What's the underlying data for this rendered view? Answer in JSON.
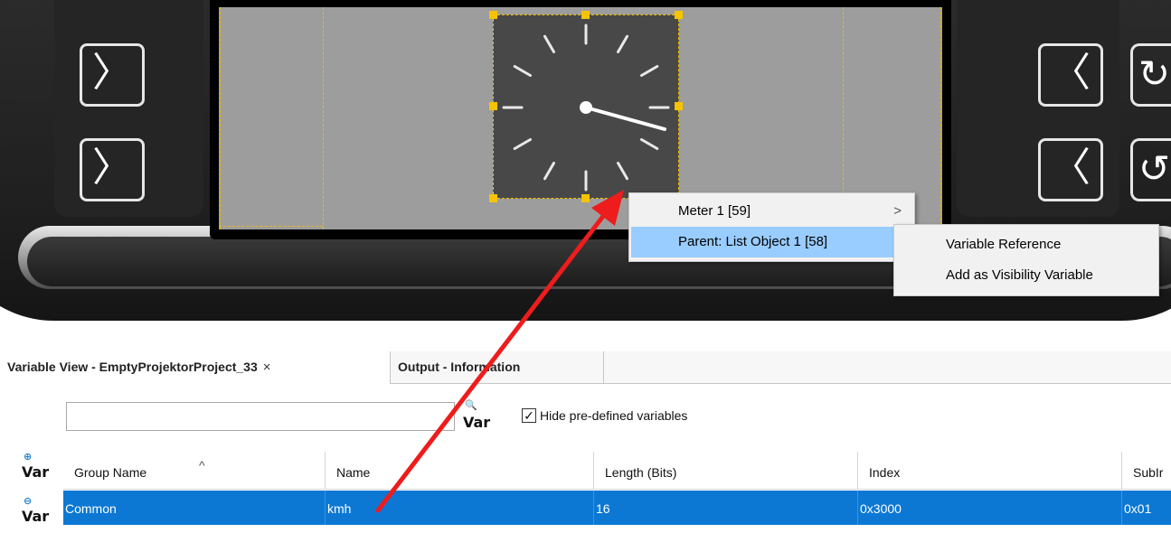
{
  "context_menu": {
    "items": [
      {
        "label": "Meter 1 [59]",
        "arrow": ">"
      },
      {
        "label": "Parent: List Object 1 [58]",
        "arrow": ">"
      }
    ]
  },
  "submenu": {
    "items": [
      {
        "label": "Variable Reference"
      },
      {
        "label": "Add as Visibility Variable"
      }
    ]
  },
  "tabs": [
    {
      "label": "Variable View - EmptyProjektorProject_33",
      "close": "×"
    },
    {
      "label": "Output - Information"
    }
  ],
  "toolbar": {
    "search_value": "",
    "var_label": "Var",
    "hide_predefined_label": "Hide pre-defined variables",
    "hide_predefined_checked": "✓"
  },
  "table": {
    "columns": [
      "Group Name",
      "Name",
      "Length (Bits)",
      "Index",
      "SubIr"
    ],
    "rows": [
      {
        "group": "Common",
        "name": "kmh",
        "length": "16",
        "index": "0x3000",
        "subindex": "0x01"
      }
    ]
  },
  "side_buttons": {
    "left_glyph": "〉",
    "right_glyph": "〈"
  },
  "colors": {
    "selection_row": "#0c78d4",
    "menu_highlight": "#99ccff",
    "selection_handles": "#f5c300",
    "annotation_arrow": "#ee1c1c"
  }
}
